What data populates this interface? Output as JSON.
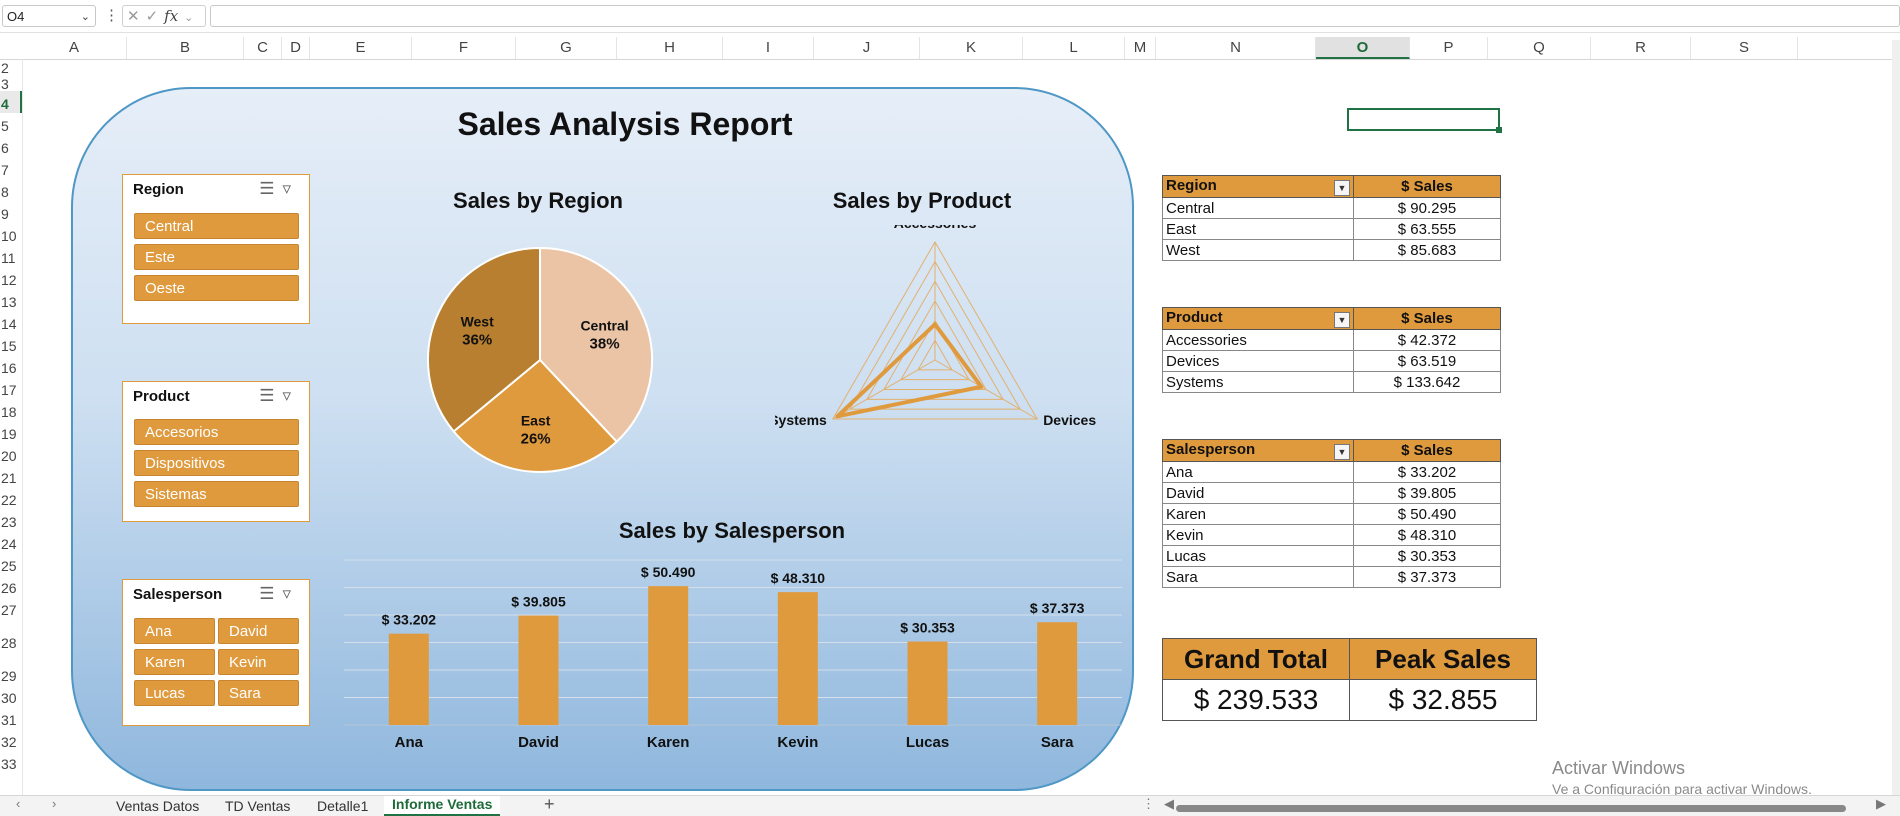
{
  "formula_bar": {
    "name_box": "O4",
    "fx": "fx",
    "formula": ""
  },
  "columns": [
    {
      "label": "A",
      "sel": false
    },
    {
      "label": "B",
      "sel": false
    },
    {
      "label": "C",
      "sel": false
    },
    {
      "label": "D",
      "sel": false
    },
    {
      "label": "E",
      "sel": false
    },
    {
      "label": "F",
      "sel": false
    },
    {
      "label": "G",
      "sel": false
    },
    {
      "label": "H",
      "sel": false
    },
    {
      "label": "I",
      "sel": false
    },
    {
      "label": "J",
      "sel": false
    },
    {
      "label": "K",
      "sel": false
    },
    {
      "label": "L",
      "sel": false
    },
    {
      "label": "M",
      "sel": false
    },
    {
      "label": "N",
      "sel": false
    },
    {
      "label": "O",
      "sel": true
    },
    {
      "label": "P",
      "sel": false
    },
    {
      "label": "Q",
      "sel": false
    },
    {
      "label": "R",
      "sel": false
    },
    {
      "label": "S",
      "sel": false
    }
  ],
  "rows": [
    "2",
    "3",
    "4",
    "5",
    "6",
    "7",
    "8",
    "9",
    "10",
    "11",
    "12",
    "13",
    "14",
    "15",
    "16",
    "17",
    "18",
    "19",
    "20",
    "21",
    "22",
    "23",
    "24",
    "25",
    "26",
    "27",
    "28",
    "29",
    "30",
    "31",
    "32",
    "33"
  ],
  "selected_row": "4",
  "dashboard": {
    "title": "Sales Analysis Report",
    "slicers": {
      "region": {
        "title": "Region",
        "items": [
          "Central",
          "Este",
          "Oeste"
        ]
      },
      "product": {
        "title": "Product",
        "items": [
          "Accesorios",
          "Dispositivos",
          "Sistemas"
        ]
      },
      "salesperson": {
        "title": "Salesperson",
        "items": [
          "Ana",
          "David",
          "Karen",
          "Kevin",
          "Lucas",
          "Sara"
        ]
      }
    },
    "slicer_icons": [
      "multi-select-icon",
      "clear-filter-icon"
    ]
  },
  "chart_data": [
    {
      "type": "pie",
      "title": "Sales by Region",
      "slices": [
        {
          "label": "Central",
          "value": 38,
          "display": "38%",
          "color": "#eac4a5"
        },
        {
          "label": "East",
          "value": 26,
          "display": "26%",
          "color": "#e09a3e"
        },
        {
          "label": "West",
          "value": 36,
          "display": "36%",
          "color": "#b77f2f"
        }
      ]
    },
    {
      "type": "radar",
      "title": "Sales by Product",
      "axes": [
        "Accessories",
        "Devices",
        "Systems"
      ],
      "values": [
        42372,
        63519,
        133642
      ],
      "ylim": [
        0,
        140000
      ],
      "color": "#e09a3e"
    },
    {
      "type": "bar",
      "title": "Sales by Salesperson",
      "categories": [
        "Ana",
        "David",
        "Karen",
        "Kevin",
        "Lucas",
        "Sara"
      ],
      "values": [
        33202,
        39805,
        50490,
        48310,
        30353,
        37373
      ],
      "labels": [
        "$ 33.202",
        "$ 39.805",
        "$ 50.490",
        "$ 48.310",
        "$ 30.353",
        "$ 37.373"
      ],
      "ylim": [
        0,
        60000
      ],
      "grid": true,
      "color": "#e09a3e"
    }
  ],
  "tables": {
    "region": {
      "headers": [
        "Region",
        "$ Sales"
      ],
      "rows": [
        [
          "Central",
          "$ 90.295"
        ],
        [
          "East",
          "$ 63.555"
        ],
        [
          "West",
          "$ 85.683"
        ]
      ]
    },
    "product": {
      "headers": [
        "Product",
        "$ Sales"
      ],
      "rows": [
        [
          "Accessories",
          "$ 42.372"
        ],
        [
          "Devices",
          "$ 63.519"
        ],
        [
          "Systems",
          "$ 133.642"
        ]
      ]
    },
    "salesperson": {
      "headers": [
        "Salesperson",
        "$ Sales"
      ],
      "rows": [
        [
          "Ana",
          "$ 33.202"
        ],
        [
          "David",
          "$ 39.805"
        ],
        [
          "Karen",
          "$ 50.490"
        ],
        [
          "Kevin",
          "$ 48.310"
        ],
        [
          "Lucas",
          "$ 30.353"
        ],
        [
          "Sara",
          "$ 37.373"
        ]
      ]
    }
  },
  "totals": {
    "grand_total_label": "Grand Total",
    "grand_total_value": "$ 239.533",
    "peak_label": "Peak Sales",
    "peak_value": "$ 32.855"
  },
  "sheet_tabs": [
    {
      "label": "Ventas Datos",
      "active": false
    },
    {
      "label": "TD Ventas",
      "active": false
    },
    {
      "label": "Detalle1",
      "active": false
    },
    {
      "label": "Informe Ventas",
      "active": true
    }
  ],
  "watermark": {
    "line1": "Activar Windows",
    "line2": "Ve a Configuración para activar Windows."
  }
}
